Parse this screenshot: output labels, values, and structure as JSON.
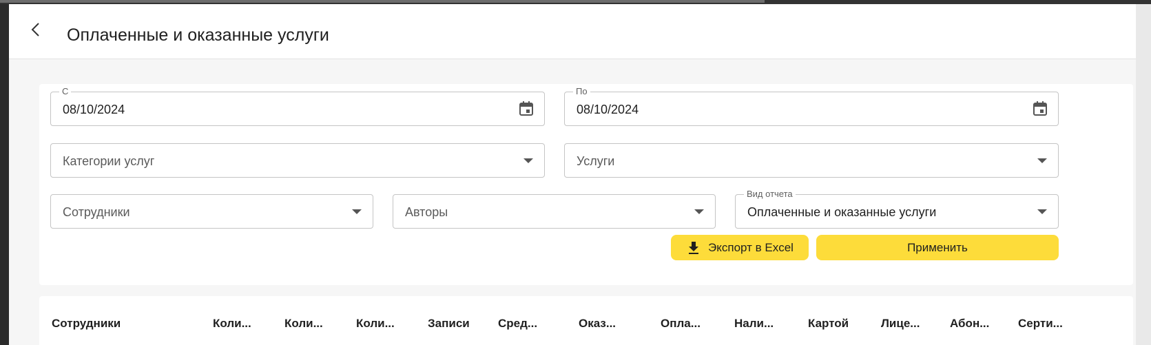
{
  "header": {
    "title": "Оплаченные и оказанные услуги"
  },
  "filters": {
    "date_from": {
      "label": "С",
      "value": "08/10/2024"
    },
    "date_to": {
      "label": "По",
      "value": "08/10/2024"
    },
    "service_categories": {
      "placeholder": "Категории услуг"
    },
    "services": {
      "placeholder": "Услуги"
    },
    "employees": {
      "placeholder": "Сотрудники"
    },
    "authors": {
      "placeholder": "Авторы"
    },
    "report_type": {
      "label": "Вид отчета",
      "value": "Оплаченные и оказанные услуги"
    }
  },
  "actions": {
    "export_label": "Экспорт в Excel",
    "apply_label": "Применить"
  },
  "table": {
    "columns": [
      "Сотрудники",
      "Коли...",
      "Коли...",
      "Коли...",
      "Записи",
      "Сред...",
      "Оказ...",
      "Опла...",
      "Нали...",
      "Картой",
      "Лице...",
      "Абон...",
      "Серти..."
    ]
  },
  "colors": {
    "accent": "#fddc3a",
    "border": "#c4c4c4"
  },
  "icons": {
    "back": "chevron-left-icon",
    "calendar": "calendar-icon",
    "dropdown": "dropdown-arrow-icon",
    "download": "download-icon"
  }
}
